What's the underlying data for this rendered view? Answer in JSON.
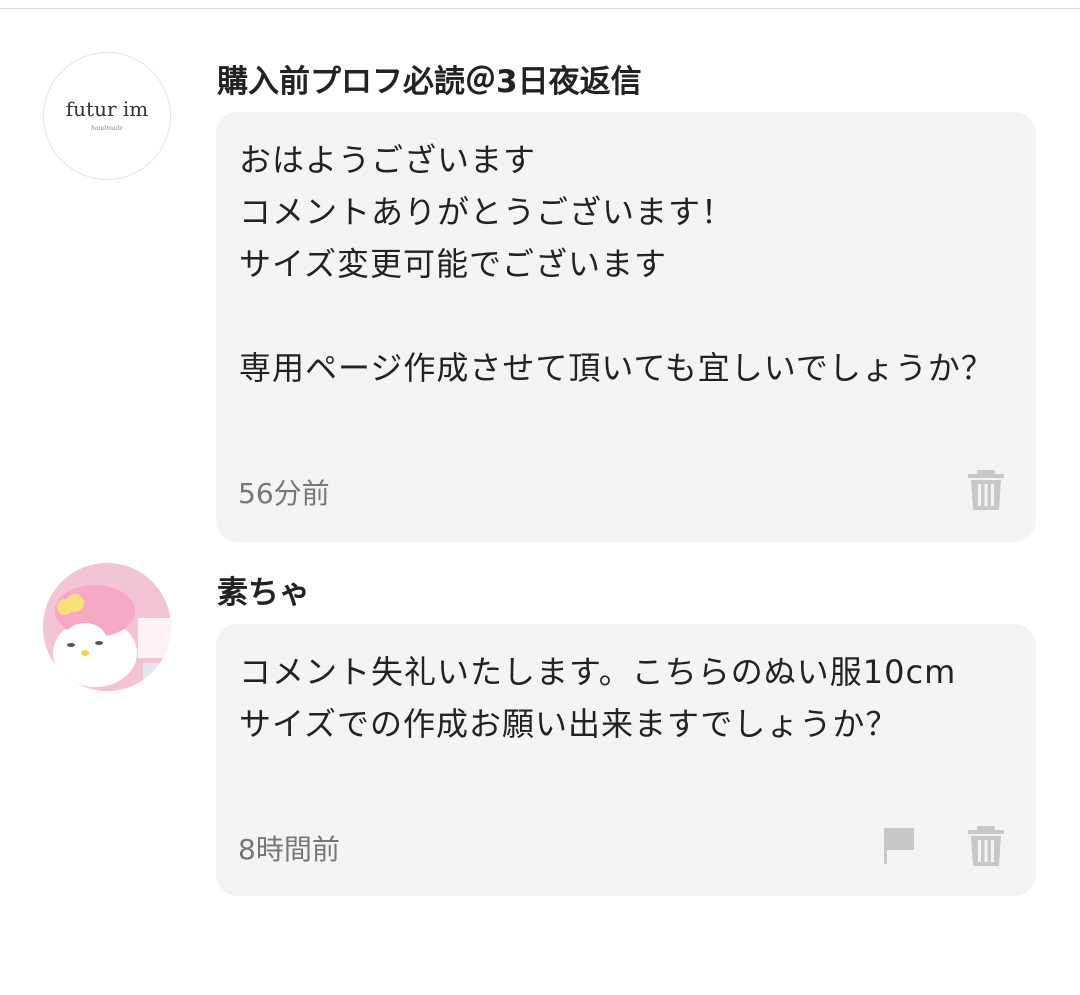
{
  "comments": [
    {
      "username": "購入前プロフ必読＠3日夜返信",
      "avatar_text": "futur im",
      "avatar_subtext": "handmade",
      "text": "おはようございます\nコメントありがとうございます！\nサイズ変更可能でございます\n\n専用ページ作成させて頂いても宜しいでしょうか？",
      "timestamp": "56分前",
      "icons": [
        "trash-icon"
      ]
    },
    {
      "username": "素ちゃ",
      "text": "コメント失礼いたします。こちらのぬい服10cmサイズでの作成お願い出来ますでしょうか？",
      "timestamp": "8時間前",
      "icons": [
        "flag-icon",
        "trash-icon"
      ]
    }
  ],
  "colors": {
    "bubble_bg": "#f4f4f4",
    "icon_gray": "#c8c8c8",
    "timestamp_gray": "#777777"
  }
}
